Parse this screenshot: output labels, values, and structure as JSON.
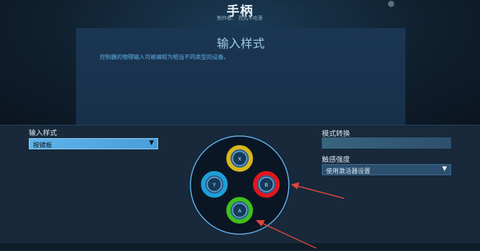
{
  "header": {
    "title": "手柄",
    "subtitle": "制作者：  烈丸不吃枣"
  },
  "panel": {
    "title": "输入样式",
    "description": "控制器的物理输入可被编程为相当不同类型的设备。"
  },
  "left": {
    "label": "输入样式",
    "select_value": "按键板"
  },
  "right": {
    "mode_label": "模式转换",
    "strength_label": "触感强度",
    "strength_value": "使用激活器设置"
  },
  "buttons": {
    "top": "X",
    "left": "Y",
    "right": "B",
    "bottom": "A"
  },
  "icons": {
    "chevron": "chevron-down-icon"
  },
  "colors": {
    "accent": "#5eb3e9",
    "button_top": "#d9b619",
    "button_left": "#1e9fd6",
    "button_right": "#e1161d",
    "button_bottom": "#3fbf1b",
    "arrow": "#e0443a"
  }
}
